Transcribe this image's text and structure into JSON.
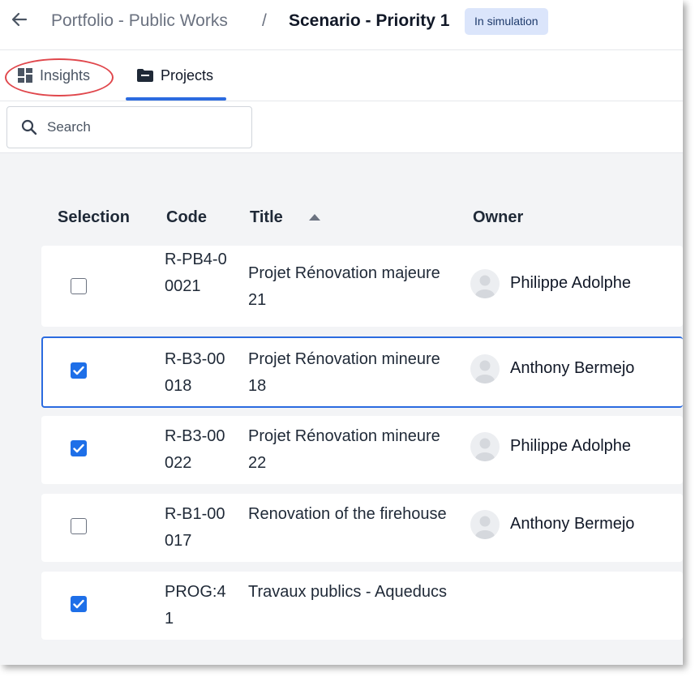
{
  "header": {
    "back_icon": "arrow-left-icon",
    "breadcrumb_parent": "Portfolio - Public Works",
    "breadcrumb_separator": "/",
    "breadcrumb_current": "Scenario - Priority 1",
    "status_badge": "In simulation"
  },
  "tabs": [
    {
      "label": "Insights",
      "icon": "dashboard-icon",
      "active": false
    },
    {
      "label": "Projects",
      "icon": "folder-icon",
      "active": true
    }
  ],
  "search": {
    "placeholder": "Search",
    "value": ""
  },
  "table": {
    "columns": [
      "Selection",
      "Code",
      "Title",
      "Owner"
    ],
    "sort": {
      "column": "Title",
      "direction": "ascending"
    },
    "rows": [
      {
        "selected": false,
        "code": "R-PB4-00021",
        "title": "Projet Rénovation majeure 21",
        "owner": "Philippe Adolphe"
      },
      {
        "selected": true,
        "code": "R-B3-00018",
        "title": "Projet Rénovation mineure 18",
        "owner": "Anthony Bermejo"
      },
      {
        "selected": true,
        "code": "R-B3-00022",
        "title": "Projet Rénovation mineure 22",
        "owner": "Philippe Adolphe"
      },
      {
        "selected": false,
        "code": "R-B1-00017",
        "title": "Renovation of the firehouse",
        "owner": "Anthony Bermejo"
      },
      {
        "selected": true,
        "code": "PROG:41",
        "title": "Travaux publics - Aqueducs",
        "owner": ""
      }
    ]
  },
  "colors": {
    "accent": "#2b6be0",
    "checkbox_checked": "#1e6fe8",
    "badge_background": "#dbe5fb",
    "annotation_circle": "#e0474c",
    "content_background": "#f3f4f6"
  }
}
